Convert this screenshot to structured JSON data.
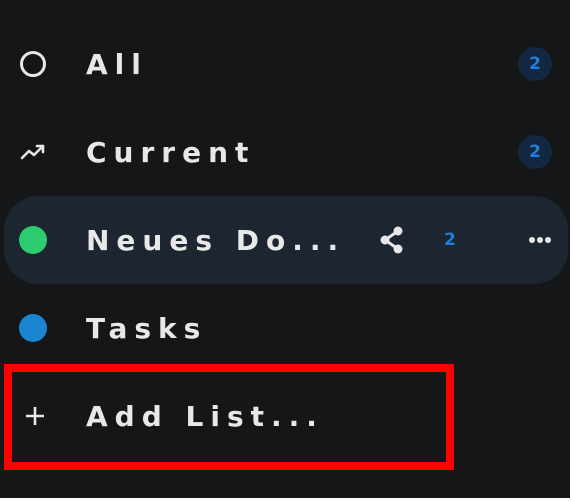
{
  "lists": {
    "all": {
      "label": "All",
      "count": "2",
      "icon": "circle-outline-icon"
    },
    "current": {
      "label": "Current",
      "count": "2",
      "icon": "trending-up-icon"
    },
    "neues": {
      "label": "Neues Do...",
      "count": "2",
      "icon": "green-dot-icon",
      "color": "#2ecc71",
      "share_icon": "share-icon",
      "more_icon": "more-dots-icon"
    },
    "tasks": {
      "label": "Tasks",
      "icon": "blue-dot-icon",
      "color": "#1a86d0"
    }
  },
  "add_list": {
    "label": "Add List...",
    "icon": "plus-icon"
  },
  "colors": {
    "background": "#151618",
    "selected_background": "#1c2530",
    "text": "#e8e8e8",
    "badge_text": "#1e7fe0",
    "badge_background": "#132840",
    "highlight": "#ff0000"
  }
}
